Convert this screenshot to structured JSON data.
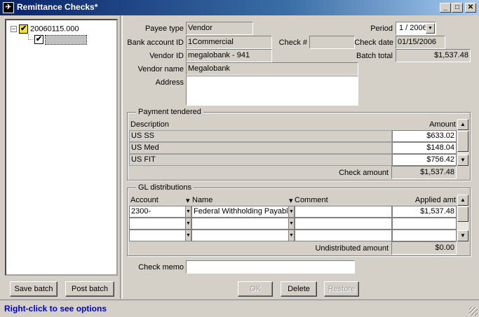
{
  "window": {
    "title": "Remittance Checks*",
    "minimize": "_",
    "maximize": "□",
    "close": "✕"
  },
  "tree": {
    "root_label": "20060115.000",
    "root_expander": "⊟",
    "child_selected": true
  },
  "left_buttons": {
    "save": "Save batch",
    "post": "Post batch"
  },
  "form": {
    "payee_type_label": "Payee type",
    "payee_type": "Vendor",
    "period_label": "Period",
    "period": "1 / 2006",
    "bank_account_label": "Bank account ID",
    "bank_account": "1Commercial",
    "check_no_label": "Check #",
    "check_no": "",
    "check_date_label": "Check date",
    "check_date": "01/15/2006",
    "vendor_id_label": "Vendor ID",
    "vendor_id": "megalobank - 941",
    "batch_total_label": "Batch total",
    "batch_total": "$1,537.48",
    "vendor_name_label": "Vendor name",
    "vendor_name": "Megalobank",
    "address_label": "Address",
    "address": ""
  },
  "payment": {
    "title": "Payment tendered",
    "col_description": "Description",
    "col_amount": "Amount",
    "rows": [
      {
        "description": "US SS",
        "amount": "$633.02"
      },
      {
        "description": "US Med",
        "amount": "$148.04"
      },
      {
        "description": "US FIT",
        "amount": "$756.42"
      }
    ],
    "check_amount_label": "Check amount",
    "check_amount": "$1,537.48"
  },
  "gl": {
    "title": "GL distributions",
    "col_account": "Account",
    "col_name": "Name",
    "col_comment": "Comment",
    "col_applied": "Applied amt",
    "rows": [
      {
        "account": "2300-",
        "name": "Federal Withholding Payable",
        "comment": "",
        "applied": "$1,537.48"
      },
      {
        "account": "",
        "name": "",
        "comment": "",
        "applied": ""
      },
      {
        "account": "",
        "name": "",
        "comment": "",
        "applied": ""
      }
    ],
    "undistributed_label": "Undistributed amount",
    "undistributed": "$0.00"
  },
  "memo": {
    "label": "Check memo",
    "value": ""
  },
  "actions": {
    "ok": "OK",
    "delete": "Delete",
    "restore": "Restore"
  },
  "status": {
    "text": "Right-click to see options"
  },
  "icons": {
    "checkbox": "✔",
    "dropdown": "▼",
    "scroll_up": "▲",
    "scroll_down": "▼",
    "small_dropdown": "▾"
  }
}
